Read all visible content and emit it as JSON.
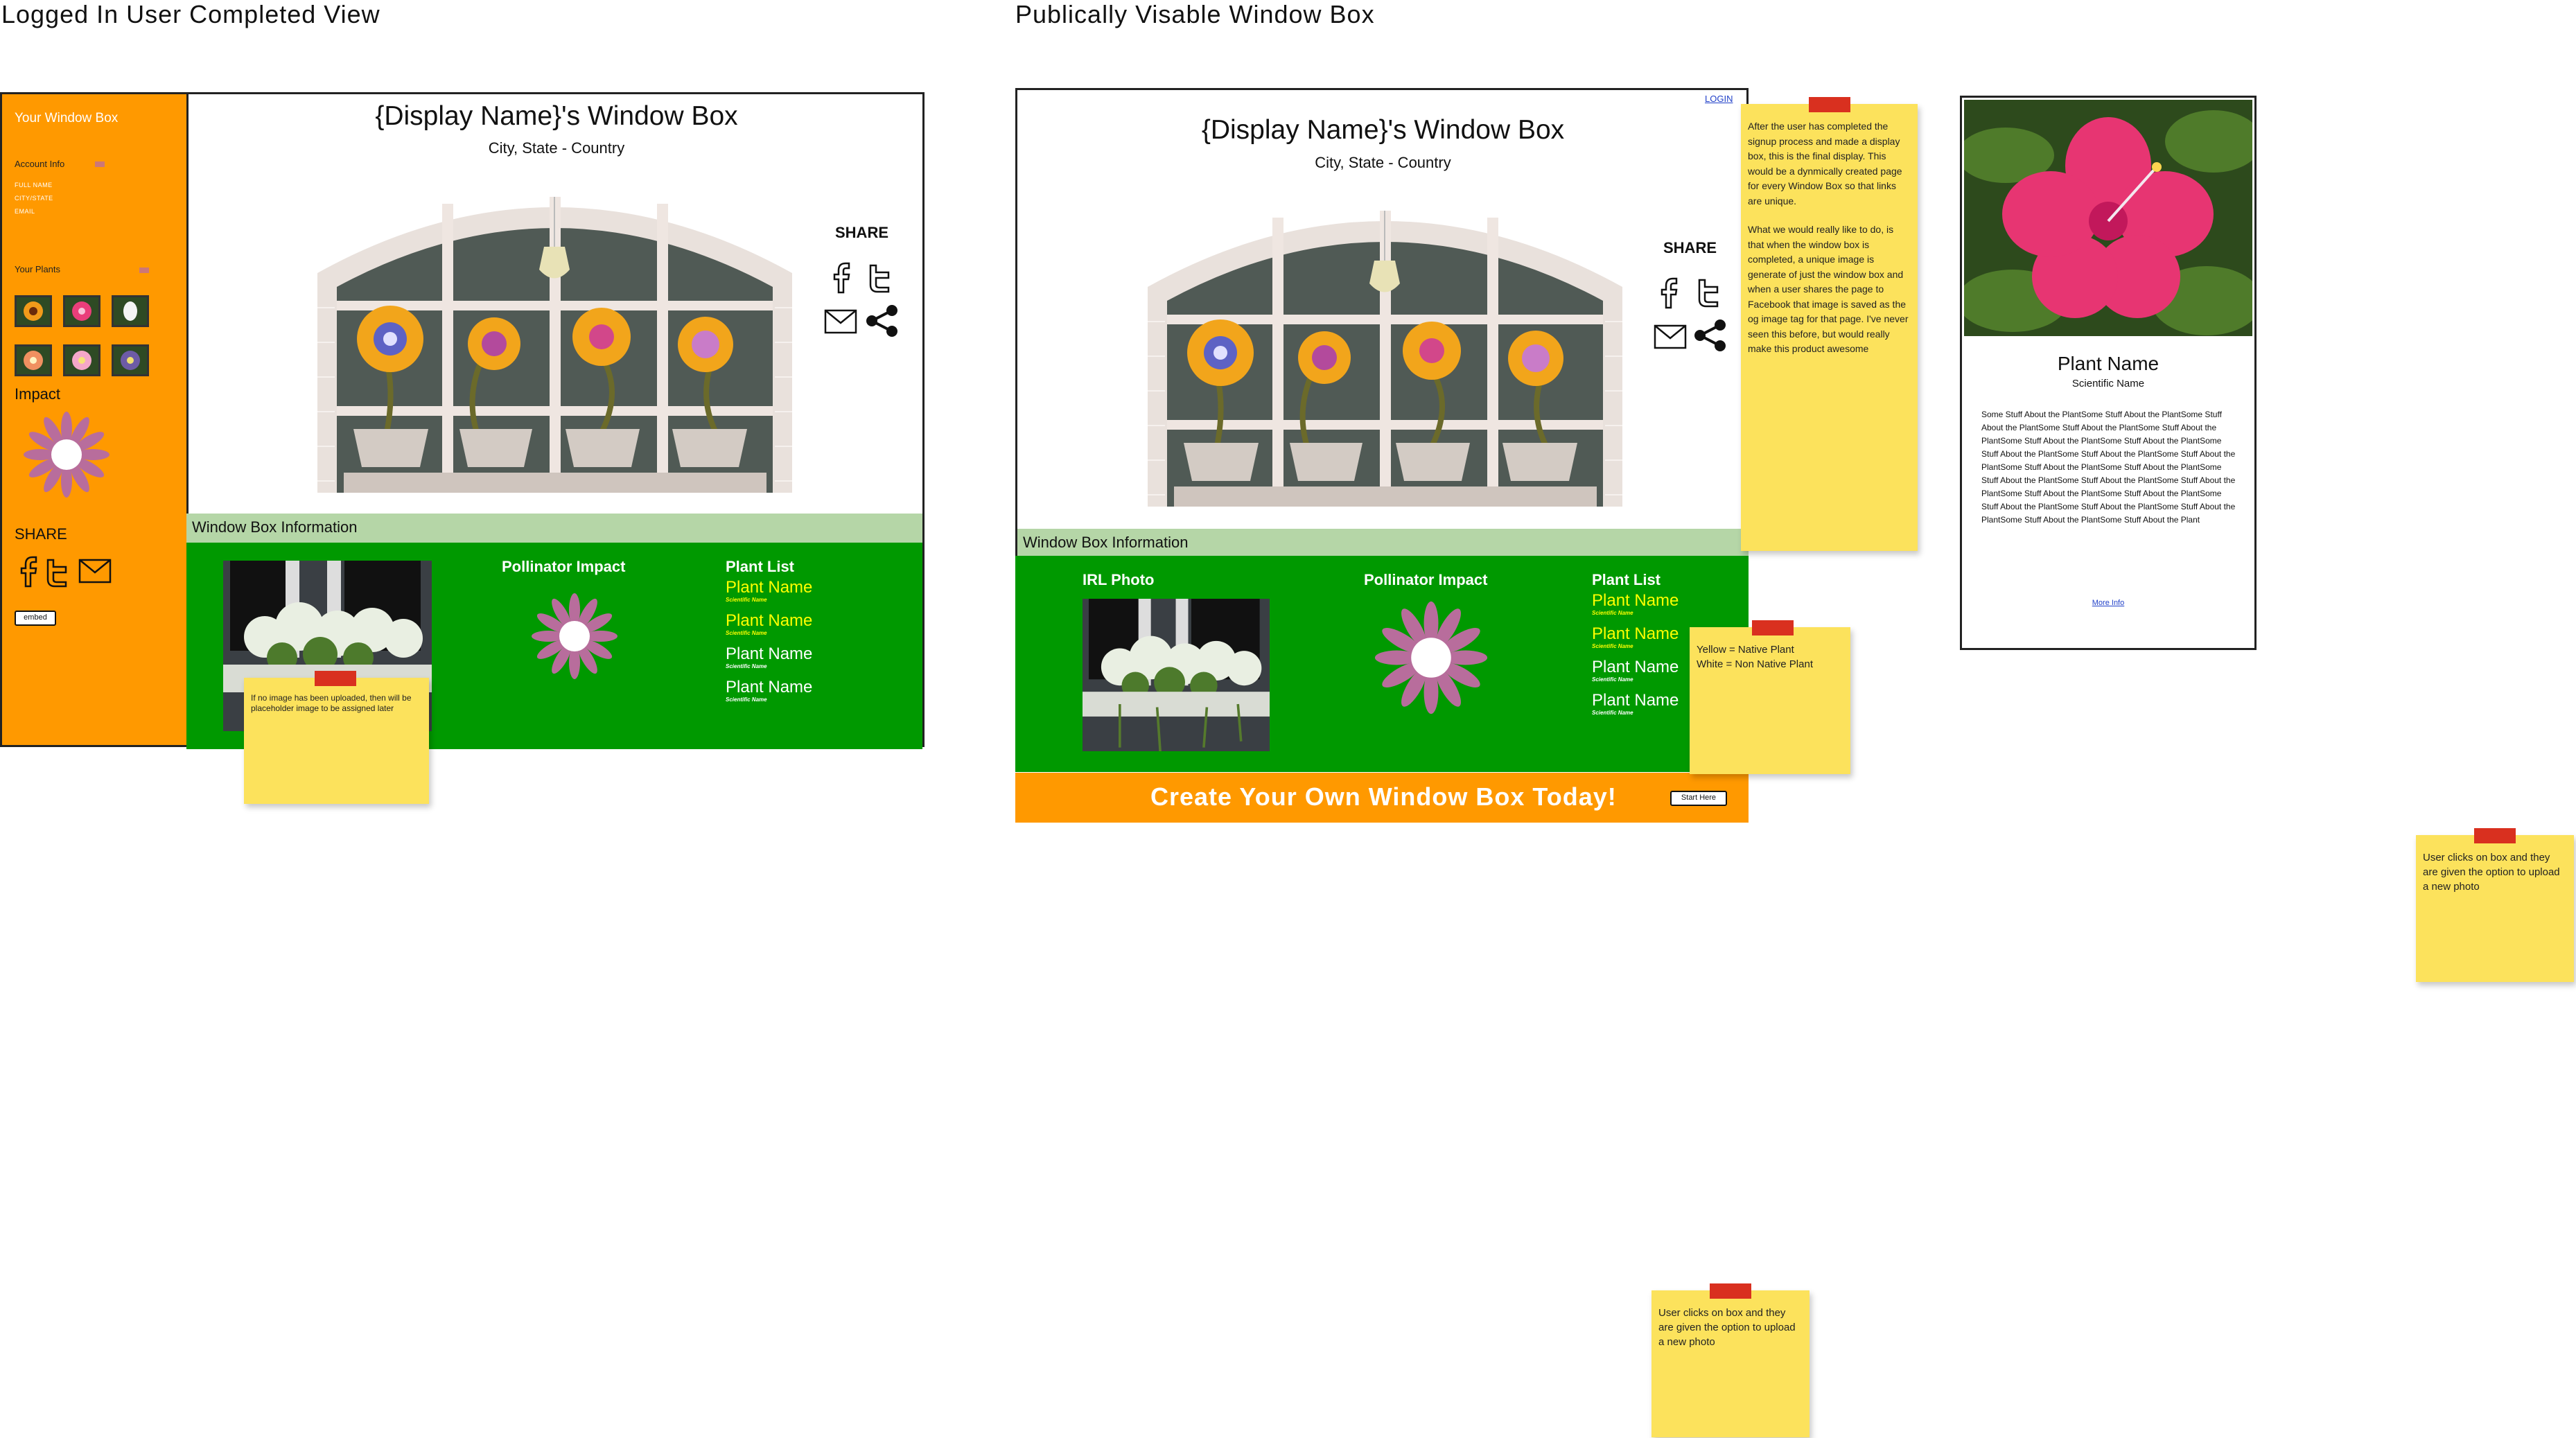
{
  "left_view": {
    "section_title": "Logged In User Completed View",
    "sidebar": {
      "heading": "Your Window Box",
      "account_info": "Account Info",
      "fields": [
        "FULL NAME",
        "CITY/STATE",
        "EMAIL"
      ],
      "your_plants": "Your Plants",
      "impact": "Impact",
      "share": "SHARE",
      "embed": "embed"
    },
    "title": "{Display Name}'s Window Box",
    "location": "City, State  - Country",
    "share": "SHARE",
    "info_bar": "Window Box Information",
    "pollinator_impact": "Pollinator Impact",
    "plant_list_heading": "Plant List",
    "plants": [
      {
        "name": "Plant Name",
        "sci": "Scientific Name",
        "native": true
      },
      {
        "name": "Plant Name",
        "sci": "Scientific Name",
        "native": true
      },
      {
        "name": "Plant Name",
        "sci": "Scientific Name",
        "native": false
      },
      {
        "name": "Plant Name",
        "sci": "Scientific Name",
        "native": false
      }
    ],
    "sticky_note": "If no image has been uploaded, then will be placeholder image to be assigned later"
  },
  "public_view": {
    "section_title": "Publically Visable Window Box",
    "login": "LOGIN",
    "title": "{Display Name}'s Window Box",
    "location": "City, State - Country",
    "share": "SHARE",
    "info_bar": "Window Box Information",
    "irl_photo": "IRL Photo",
    "pollinator_impact": "Pollinator Impact",
    "plant_list_heading": "Plant List",
    "plants": [
      {
        "name": "Plant Name",
        "sci": "Scientific Name",
        "native": true
      },
      {
        "name": "Plant Name",
        "sci": "Scientific Name",
        "native": true
      },
      {
        "name": "Plant Name",
        "sci": "Scientific Name",
        "native": false
      },
      {
        "name": "Plant Name",
        "sci": "Scientific Name",
        "native": false
      }
    ],
    "cta": "Create Your Own Window Box Today!",
    "start_button": "Start Here"
  },
  "notes": {
    "signup_note": "After the user has completed the signup process and made a display box, this is the final display. This would be a dynmically created page for every Window Box so that links are unique.",
    "signup_note_2": "What we would really like to do, is that when the window box is completed, a unique image is generate of just the window box and when a user shares the page to Facebook that image is saved as the og image tag for that page. I've never seen this before, but would really make this product awesome",
    "legend_yellow": "Yellow = Native Plant",
    "legend_white": "White = Non Native Plant",
    "upload_note": "User clicks on box and they are given the option to upload a new photo",
    "upload_note_2": "User clicks on box and they are given the option to upload a new photo"
  },
  "plant_card": {
    "name": "Plant Name",
    "sci": "Scientific Name",
    "description": "Some Stuff About the PlantSome Stuff About the PlantSome Stuff About the PlantSome Stuff About the PlantSome Stuff About the PlantSome Stuff About the PlantSome Stuff About the PlantSome Stuff About the PlantSome Stuff About the PlantSome Stuff About the PlantSome Stuff About the PlantSome Stuff About the PlantSome Stuff About the PlantSome Stuff About the PlantSome Stuff About the PlantSome Stuff About the PlantSome Stuff About the PlantSome Stuff About the PlantSome Stuff About the PlantSome Stuff About the PlantSome Stuff About the PlantSome Stuff About the Plant",
    "more_info": "More Info"
  },
  "colors": {
    "orange": "#ff9900",
    "green": "#009900",
    "info_bar": "#b5d6a7",
    "sticky": "#fce25c",
    "native": "#ffff00",
    "non_native": "#ffffff"
  }
}
